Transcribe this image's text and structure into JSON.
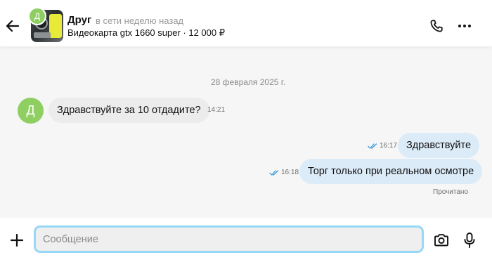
{
  "header": {
    "back_icon": "arrow-left-icon",
    "contact_avatar_letter": "Д",
    "contact_name": "Друг",
    "contact_status": "в сети неделю назад",
    "listing_info": "Видеокарта gtx 1660 super · 12 000 ₽",
    "call_icon": "phone-icon",
    "more_icon": "more-horizontal-icon"
  },
  "chat": {
    "date_separator": "28 февраля 2025 г.",
    "messages": [
      {
        "direction": "incoming",
        "avatar_letter": "Д",
        "text": "Здравствуйте за 10 отдадите?",
        "time": "14:21"
      },
      {
        "direction": "outgoing",
        "text": "Здравствуйте",
        "time": "16:17",
        "status_icon": "double-check-icon"
      },
      {
        "direction": "outgoing",
        "text": "Торг только при реальном осмотре",
        "time": "16:18",
        "status_icon": "double-check-icon"
      }
    ],
    "read_status": "Прочитано"
  },
  "composer": {
    "attach_icon": "plus-icon",
    "input_value": "",
    "input_placeholder": "Сообщение",
    "camera_icon": "camera-icon",
    "mic_icon": "microphone-icon"
  },
  "colors": {
    "incoming_bubble": "#ececec",
    "outgoing_bubble": "#dcebf8",
    "avatar": "#8fcf62",
    "input_focus_border": "#97d8f5",
    "read_check": "#3a9be0"
  }
}
